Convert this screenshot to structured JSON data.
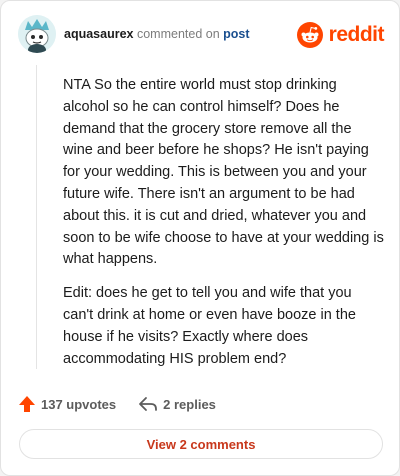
{
  "header": {
    "username": "aquasaurex",
    "commented_text": "commented on",
    "post_link": "post",
    "brand_name": "reddit",
    "brand_color": "#ff4500",
    "avatar_icon": "snoo-avatar-icon"
  },
  "comment": {
    "paragraphs": [
      "NTA So the entire world must stop drinking alcohol so he can control himself? Does he demand that the grocery store remove all the wine and beer before he shops? He isn't paying for your wedding. This is between you and your future wife. There isn't an argument to be had about this. it is cut and dried, whatever you and soon to be wife choose to have at your wedding is what happens.",
      "Edit: does he get to tell you and wife that you can't drink at home or even have booze in the house if he visits? Exactly where does accommodating HIS problem end?"
    ]
  },
  "actions": {
    "upvotes": "137 upvotes",
    "replies": "2 replies",
    "upvote_icon": "upvote-arrow-icon",
    "reply_icon": "reply-arrow-icon"
  },
  "footer": {
    "view_comments": "View 2 comments"
  }
}
